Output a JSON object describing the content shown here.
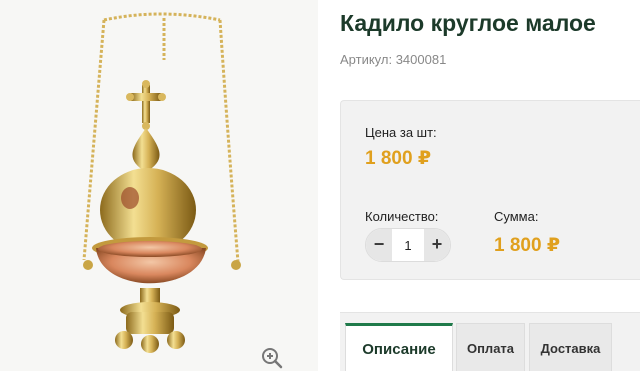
{
  "product": {
    "title": "Кадило круглое малое",
    "sku": "Артикул: 3400081"
  },
  "pricing": {
    "price_label": "Цена за шт:",
    "price_value": "1 800 ₽",
    "quantity_label": "Количество:",
    "quantity_value": "1",
    "quantity_minus": "−",
    "quantity_plus": "+",
    "sum_label": "Сумма:",
    "sum_value": "1 800 ₽"
  },
  "tabs": [
    {
      "label": "Описание",
      "active": true
    },
    {
      "label": "Оплата",
      "active": false
    },
    {
      "label": "Доставка",
      "active": false
    }
  ],
  "icons": {
    "zoom": "zoom-in-icon",
    "cross": "cross-icon"
  },
  "colors": {
    "price": "#e0a01e",
    "title": "#1c3a2a",
    "tab_accent": "#1f7a4a",
    "brass": "#c9a545"
  }
}
